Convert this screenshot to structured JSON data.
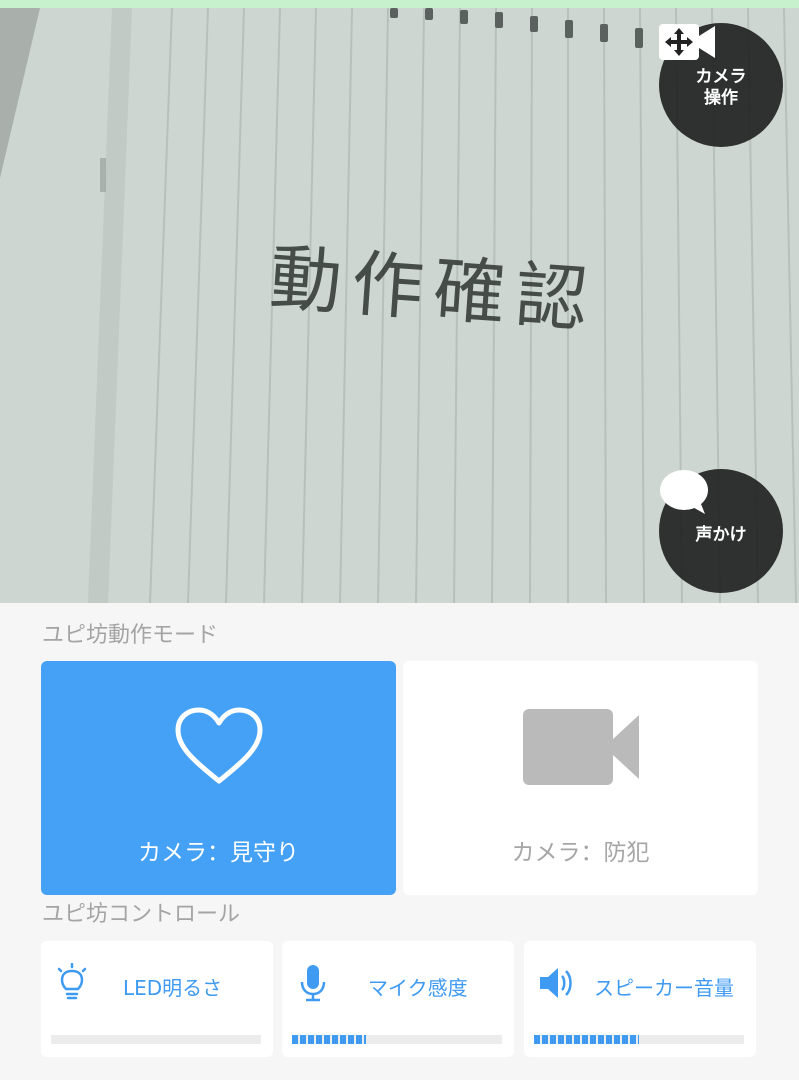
{
  "camera_view": {
    "handwritten_text": "動作確認",
    "camera_control_button": {
      "label_line1": "カメラ",
      "label_line2": "操作",
      "icon": "move-camera-icon"
    },
    "talk_button": {
      "label": "声かけ",
      "icon": "speech-bubble-icon"
    }
  },
  "mode_section": {
    "title": "ユピ坊動作モード",
    "modes": [
      {
        "label": "カメラ：見守り",
        "icon": "heart-icon",
        "selected": true,
        "color": "#44a1f6"
      },
      {
        "label": "カメラ：防犯",
        "icon": "video-camera-icon",
        "selected": false
      }
    ]
  },
  "control_section": {
    "title": "ユピ坊コントロール",
    "controls": [
      {
        "label": "LED明るさ",
        "icon": "lightbulb-icon",
        "level": 0.0
      },
      {
        "label": "マイク感度",
        "icon": "microphone-icon",
        "level": 0.35
      },
      {
        "label": "スピーカー音量",
        "icon": "speaker-icon",
        "level": 0.5
      }
    ],
    "accent_color": "#3f9af2"
  }
}
